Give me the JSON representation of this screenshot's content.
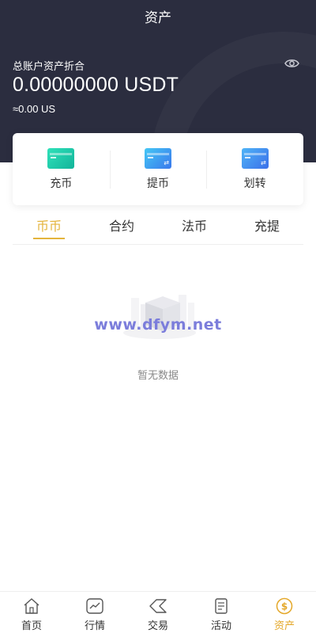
{
  "header": {
    "title": "资产",
    "total_label": "总账户资产折合",
    "total_value": "0.00000000 USDT",
    "total_fiat": "≈0.00 US"
  },
  "actions": [
    {
      "label": "充币",
      "icon": "deposit-card-icon"
    },
    {
      "label": "提币",
      "icon": "withdraw-card-icon"
    },
    {
      "label": "划转",
      "icon": "transfer-card-icon"
    }
  ],
  "tabs": [
    {
      "label": "币币",
      "active": true
    },
    {
      "label": "合约",
      "active": false
    },
    {
      "label": "法币",
      "active": false
    },
    {
      "label": "充提",
      "active": false
    }
  ],
  "empty": {
    "watermark": "www.dfym.net",
    "text": "暂无数据"
  },
  "tabbar": [
    {
      "label": "首页",
      "icon": "home-icon"
    },
    {
      "label": "行情",
      "icon": "market-chart-icon"
    },
    {
      "label": "交易",
      "icon": "trade-icon"
    },
    {
      "label": "活动",
      "icon": "activity-icon"
    },
    {
      "label": "资产",
      "icon": "assets-icon",
      "active": true
    }
  ],
  "colors": {
    "header_bg": "#2b2d3f",
    "accent": "#e4b43c",
    "tabbar_active": "#e4a82a"
  }
}
